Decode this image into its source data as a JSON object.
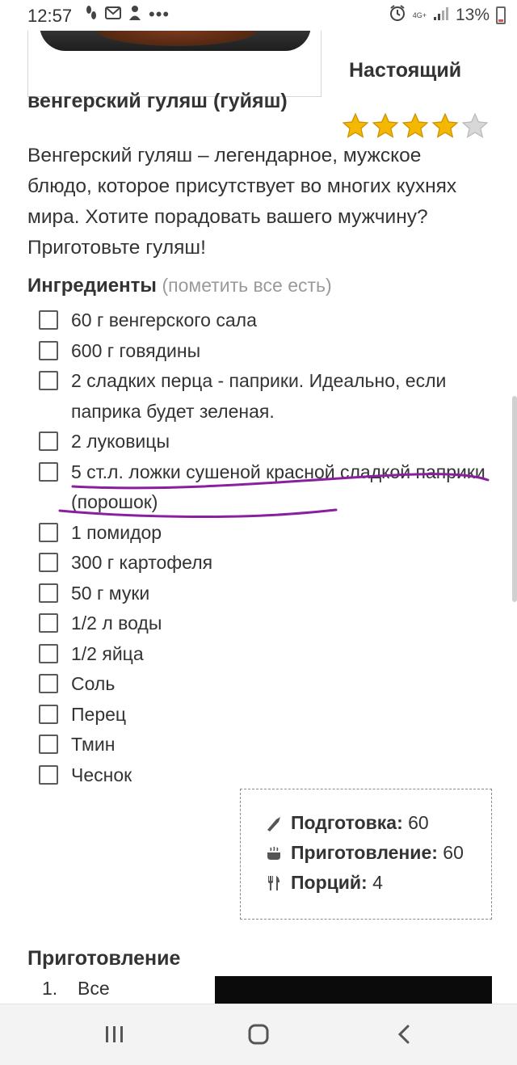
{
  "status_bar": {
    "time": "12:57",
    "network_label": "4G+",
    "battery_text": "13%",
    "icons": [
      "steps-icon",
      "message-icon",
      "person-icon",
      "more-icon",
      "alarm-icon",
      "signal-icon",
      "battery-icon"
    ]
  },
  "recipe": {
    "title_line1": "Настоящий",
    "title_line2": "венгерский гуляш (гуйяш)",
    "rating": 4,
    "rating_max": 5,
    "description": "Венгерский гуляш – легендарное, мужское блюдо, которое присутствует во многих кухнях мира. Хотите порадовать вашего мужчину? Приготовьте гуляш!"
  },
  "ingredients": {
    "heading": "Ингредиенты",
    "mark_all": "(пометить все есть)",
    "items": [
      "60 г венгерского сала",
      "600 г говядины",
      "2 сладких перца - паприки. Идеально, если паприка будет зеленая.",
      "2 луковицы",
      "5 ст.л. ложки сушеной красной сладкой паприки (порошок)",
      "1 помидор",
      "300 г картофеля",
      "50 г муки",
      "1/2 л воды",
      "1/2 яйца",
      "Соль",
      "Перец",
      "Тмин",
      "Чеснок"
    ]
  },
  "meta": {
    "prep_label": "Подготовка:",
    "prep_value": "60",
    "cook_label": "Приготовление:",
    "cook_value": "60",
    "servings_label": "Порций:",
    "servings_value": "4"
  },
  "preparation": {
    "heading": "Приготовление",
    "step1_num": "1.",
    "step1_text": "Все"
  },
  "colors": {
    "text": "#333333",
    "muted": "#9a9a9a",
    "star_fill": "#f5b800",
    "star_empty": "#d8d8d8",
    "annotation": "#8a1fa0"
  }
}
